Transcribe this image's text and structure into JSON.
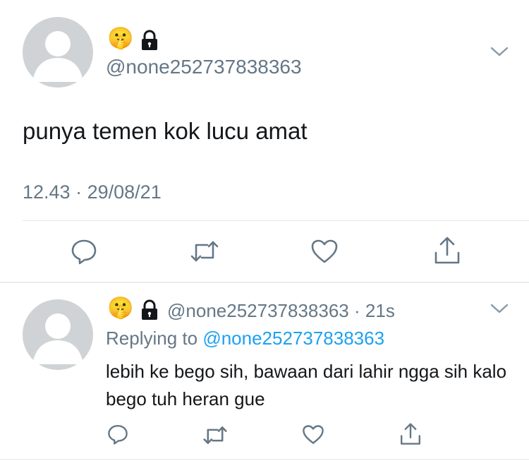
{
  "tweet": {
    "handle": "@none252737838363",
    "emoji": "🤫",
    "text": "punya temen kok lucu amat",
    "time": "12.43",
    "date": "29/08/21",
    "separator": "·"
  },
  "reply": {
    "emoji": "🤫",
    "handle": "@none252737838363",
    "separator": "·",
    "age": "21s",
    "replying_prefix": "Replying to",
    "replying_handle": "@none252737838363",
    "text": "lebih ke bego sih, bawaan dari lahir ngga sih kalo bego tuh heran gue"
  },
  "icons": {
    "reply": "reply-icon",
    "retweet": "retweet-icon",
    "like": "heart-icon",
    "share": "share-icon",
    "menu": "chevron-down-icon",
    "lock": "lock-icon"
  },
  "colors": {
    "link": "#1da1f2",
    "secondary_text": "#657786",
    "icon": "#657786",
    "avatar_bg": "#cfd3d6"
  }
}
